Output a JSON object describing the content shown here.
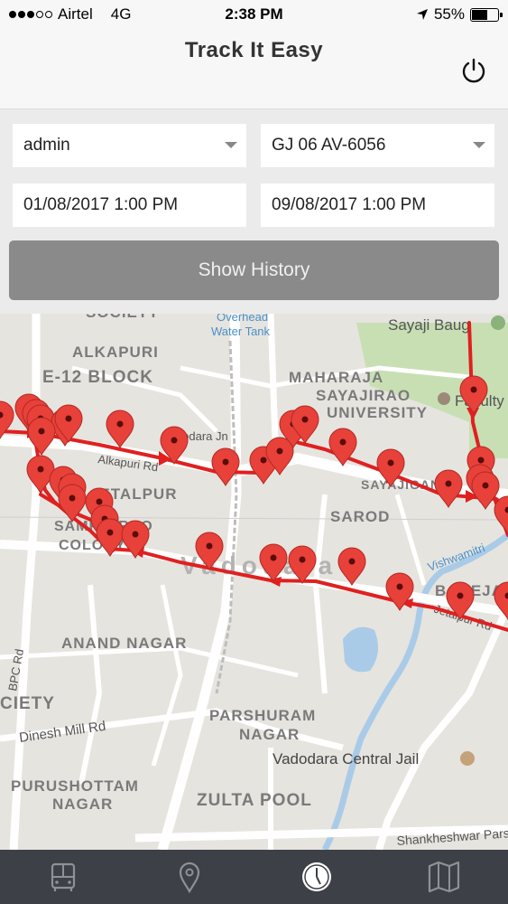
{
  "status_bar": {
    "carrier": "Airtel",
    "network": "4G",
    "time": "2:38 PM",
    "battery": "55%",
    "battery_level": 0.55
  },
  "header": {
    "title": "Track It Easy",
    "power_icon": "power-icon"
  },
  "filters": {
    "user_select": "admin",
    "vehicle_select": "GJ 06 AV-6056",
    "from_datetime": "01/08/2017 1:00 PM",
    "to_datetime": "09/08/2017 1:00 PM",
    "show_history_label": "Show History"
  },
  "map": {
    "labels": {
      "society_top": "SOCIETY",
      "overhead": "Overhead",
      "water_tank": "Water Tank",
      "sayaji_baug": "Sayaji Baug",
      "alkapuri": "ALKAPURI",
      "e12_block": "E-12 BLOCK",
      "maharaja1": "MAHARAJA",
      "maharaja2": "SAYAJIRAO",
      "maharaja3": "UNIVERSITY",
      "faculty": "Faculty",
      "vadodara_station": "Vadodara Jn",
      "alkapuri_rd": "Alkapuri Rd",
      "sayajiganj": "SAYAJIGANJ",
      "jetalpur": "JETALPUR",
      "sarod": "SAROD",
      "sampatrao1": "SAMPATRAO",
      "sampatrao2": "COLONY",
      "vadodara_city": "Vadodara",
      "vishwamitri": "Vishwamitri",
      "bareja": "BAREJA",
      "jetalpur_rd": "Jetalpur Rd",
      "anand_nagar": "ANAND NAGAR",
      "bpc_rd": "BPC Rd",
      "society_left": "CIETY",
      "dinesh_mill": "Dinesh Mill Rd",
      "parshuram1": "PARSHURAM",
      "parshuram2": "NAGAR",
      "central_jail": "Vadodara Central Jail",
      "purushottam1": "PURUSHOTTAM",
      "purushottam2": "NAGAR",
      "zulta_pool": "ZULTA POOL",
      "shankheshwar": "Shankheshwar Parshwanath M"
    },
    "route_color": "#e02020",
    "marker_color": "#e8413a"
  },
  "tab_bar": {
    "tabs": [
      {
        "name": "bus-icon",
        "active": false
      },
      {
        "name": "location-pin-icon",
        "active": false
      },
      {
        "name": "clock-icon",
        "active": true
      },
      {
        "name": "map-icon",
        "active": false
      }
    ],
    "icon_color": "#8e9196",
    "active_color": "#ffffff"
  }
}
